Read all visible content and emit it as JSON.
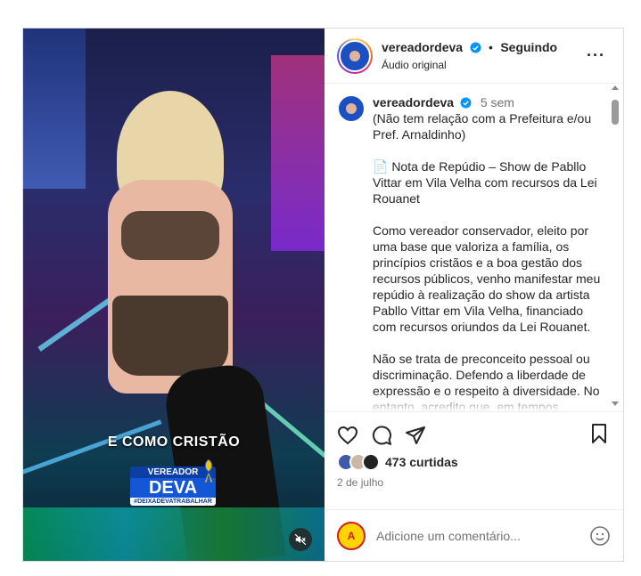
{
  "header": {
    "username": "vereadordeva",
    "separator": "•",
    "follow_status": "Seguindo",
    "audio": "Áudio original",
    "more": "···"
  },
  "media": {
    "overlay_caption": "E COMO CRISTÃO",
    "badge_top": "VEREADOR",
    "badge_name": "DEVA",
    "badge_tag": "#DEIXADEVATRABALHAR",
    "mute_icon": "speaker-muted-icon"
  },
  "caption": {
    "username": "vereadordeva",
    "time": "5 sem",
    "paragraphs": [
      "(Não tem relação com a Prefeitura e/ou Pref. Arnaldinho)",
      "📄 Nota de Repúdio – Show de Pabllo Vittar em Vila Velha com recursos da Lei Rouanet",
      "Como vereador conservador, eleito por uma base que valoriza a família, os princípios cristãos e a boa gestão dos recursos públicos, venho manifestar meu repúdio à realização do show da artista Pabllo Vittar em Vila Velha, financiado com recursos oriundos da Lei Rouanet.",
      "Não se trata de preconceito pessoal ou discriminação. Defendo a liberdade de expressão e o respeito à diversidade. No entanto, acredito que, em tempos"
    ]
  },
  "actions": {
    "icons": [
      "heart-icon",
      "comment-icon",
      "share-icon",
      "bookmark-icon"
    ],
    "likes": "473 curtidas",
    "date": "2 de julho"
  },
  "comment": {
    "avatar_text": "A",
    "placeholder": "Adicione um comentário...",
    "emoji_icon": "emoji-icon"
  },
  "colors": {
    "brand_blue": "#1356d6",
    "verified": "#0095f6",
    "text": "#262626",
    "muted": "#737373"
  }
}
